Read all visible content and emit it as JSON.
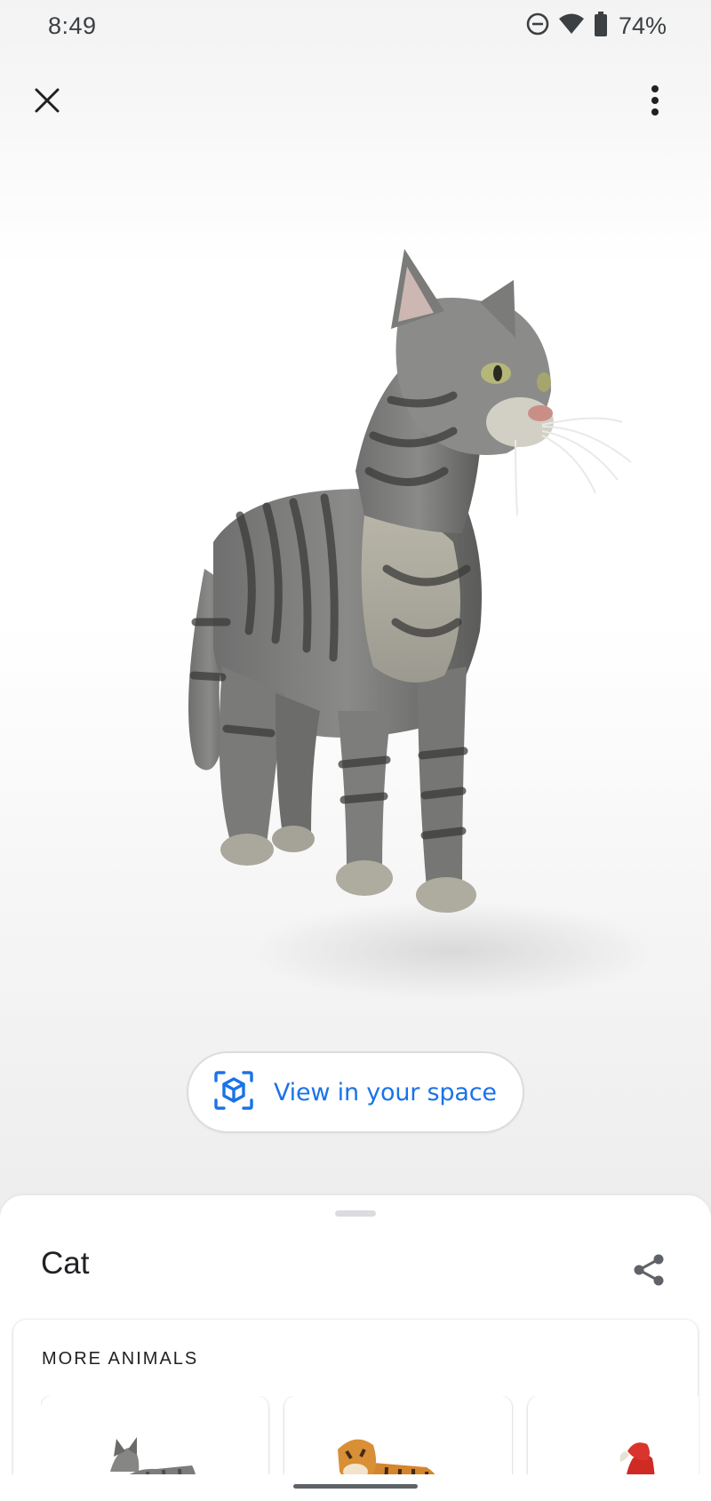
{
  "status_bar": {
    "time": "8:49",
    "battery_percent": "74%",
    "icons": [
      "do-not-disturb-icon",
      "wifi-icon",
      "battery-icon"
    ]
  },
  "top_bar": {
    "icons": [
      "close-icon",
      "more-vert-icon"
    ]
  },
  "model": {
    "icon": "cat-3d-model"
  },
  "ar_button": {
    "label": "View in your space",
    "icon": "view-in-ar-icon",
    "color": "#1a73e8"
  },
  "sheet": {
    "title": "Cat",
    "share_icon": "share-icon",
    "more_section": {
      "heading": "MORE ANIMALS",
      "items": [
        {
          "icon": "tabby-cat-thumbnail"
        },
        {
          "icon": "tiger-thumbnail"
        },
        {
          "icon": "parrot-thumbnail"
        }
      ]
    }
  }
}
